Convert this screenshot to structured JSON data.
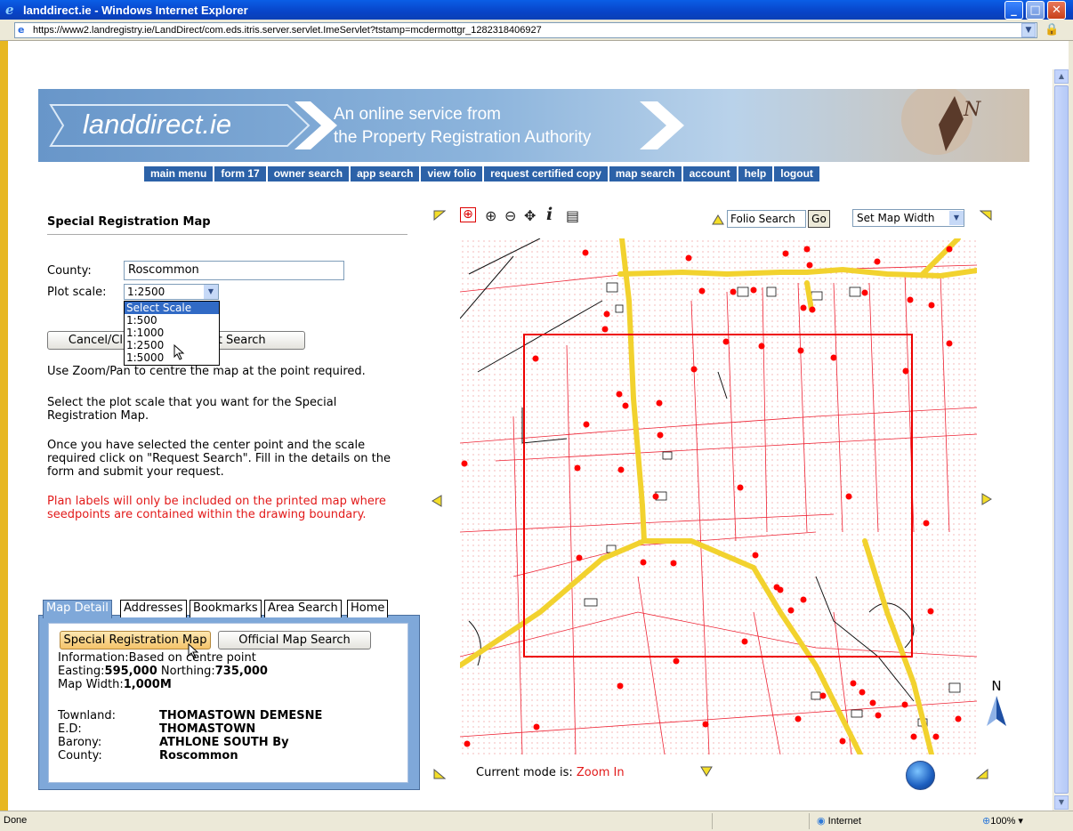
{
  "window": {
    "title": "landdirect.ie - Windows Internet Explorer",
    "url": "https://www2.landregistry.ie/LandDirect/com.eds.itris.server.servlet.ImeServlet?tstamp=mcdermottgr_1282318406927"
  },
  "status": {
    "text": "Done",
    "zone": "Internet",
    "zoom": "100%"
  },
  "banner": {
    "logo": "landdirect.ie",
    "tagline1": "An online service from",
    "tagline2": "the Property Registration Authority"
  },
  "nav": [
    "main menu",
    "form 17",
    "owner search",
    "app search",
    "view folio",
    "request certified copy",
    "map search",
    "account",
    "help",
    "logout"
  ],
  "form": {
    "title": "Special Registration Map",
    "county_label": "County:",
    "county_value": "Roscommon",
    "scale_label": "Plot scale:",
    "scale_value": "1:2500",
    "scale_options": [
      "Select Scale",
      "1:500",
      "1:1000",
      "1:2500",
      "1:5000"
    ],
    "cancel_label": "Cancel/Cl",
    "request_label": "est Search",
    "help1": "Use Zoom/Pan to centre the map at the point required.",
    "help2": "Select the plot scale that you want for the Special Registration Map.",
    "help3": "Once you have selected the center point and the scale required click on \"Request Search\". Fill in the details on the form and submit your request.",
    "warning": "Plan labels will only be included on the printed map where seedpoints are contained within the drawing boundary."
  },
  "tabs": [
    "Map Detail",
    "Addresses",
    "Bookmarks",
    "Area Search",
    "Home"
  ],
  "detail": {
    "btn_special": "Special Registration Map",
    "btn_official": "Official Map Search",
    "info": "Information:Based on centre point",
    "easting_label": "Easting:",
    "easting": "595,000",
    "northing_label": "Northing:",
    "northing": "735,000",
    "width_label": "Map Width:",
    "width": "1,000M",
    "townland_label": "Townland:",
    "townland": "THOMASTOWN DEMESNE",
    "ed_label": "E.D:",
    "ed": "THOMASTOWN",
    "barony_label": "Barony:",
    "barony": "ATHLONE SOUTH By",
    "county_label": "County:",
    "county": "Roscommon"
  },
  "map": {
    "folio_search": "Folio Search",
    "go": "Go",
    "width_select": "Set Map Width",
    "mode_label": "Current mode is:",
    "mode": "Zoom In",
    "north": "N",
    "tools": [
      "zoom-box-icon",
      "zoom-in-icon",
      "zoom-out-icon",
      "pan-icon",
      "info-icon",
      "list-icon"
    ]
  },
  "colors": {
    "nav_bg": "#2c62a8",
    "red_text": "#e21a1a",
    "road": "#f3d23a",
    "boundary": "#d81b1b"
  }
}
